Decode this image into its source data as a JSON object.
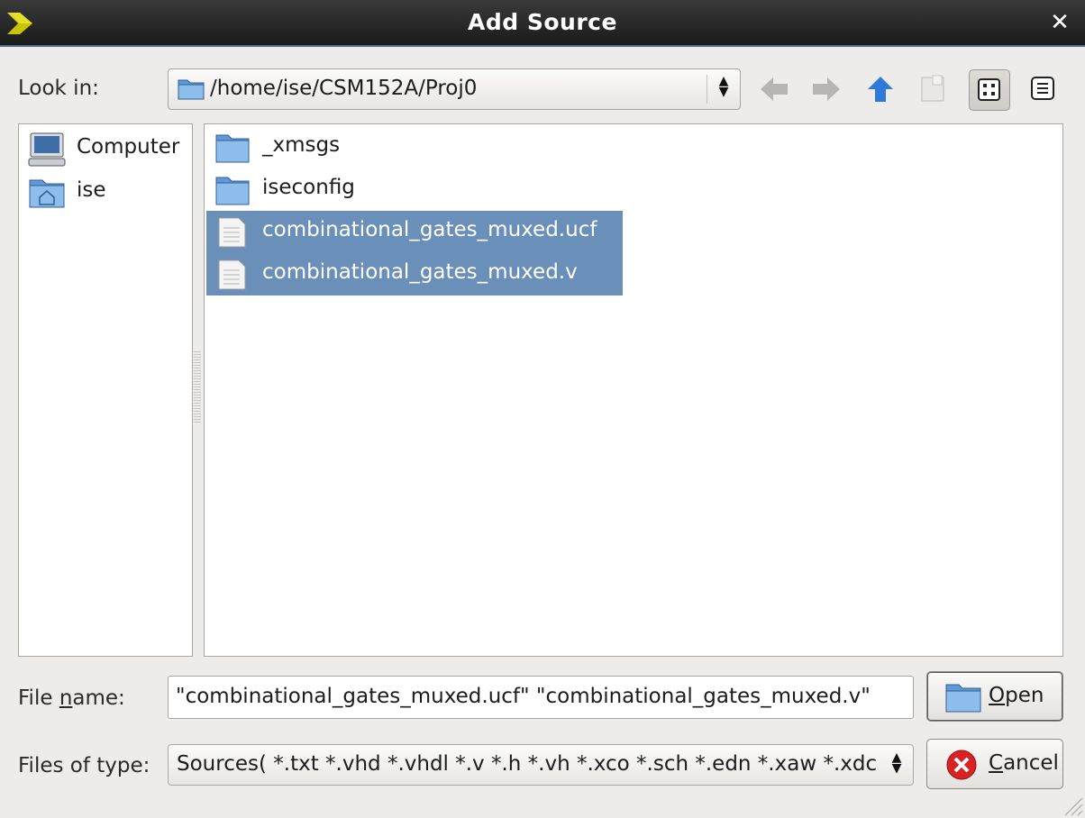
{
  "window": {
    "title": "Add Source"
  },
  "toolbar": {
    "look_in_label": "Look in:",
    "look_in_path": "/home/ise/CSM152A/Proj0",
    "back_icon": "arrow-left-icon",
    "forward_icon": "arrow-right-icon",
    "up_icon": "arrow-up-icon",
    "new_folder_icon": "new-folder-icon",
    "list_view_icon": "list-view-icon",
    "detail_view_icon": "detail-view-icon",
    "active_view": "list"
  },
  "sidebar": {
    "items": [
      {
        "label": "Computer",
        "icon": "computer-icon"
      },
      {
        "label": "ise",
        "icon": "home-folder-icon"
      }
    ]
  },
  "files": [
    {
      "name": "_xmsgs",
      "kind": "folder",
      "selected": false
    },
    {
      "name": "iseconfig",
      "kind": "folder",
      "selected": false
    },
    {
      "name": "combinational_gates_muxed.ucf",
      "kind": "file",
      "selected": true
    },
    {
      "name": "combinational_gates_muxed.v",
      "kind": "file",
      "selected": true
    }
  ],
  "bottom": {
    "file_name_label_pre": "File ",
    "file_name_label_mnemonic": "n",
    "file_name_label_post": "ame:",
    "file_name_value": "\"combinational_gates_muxed.ucf\" \"combinational_gates_muxed.v\"",
    "files_of_type_label": "Files of type:",
    "files_of_type_value": "Sources( *.txt *.vhd *.vhdl *.v *.h *.vh *.xco *.sch *.edn *.xaw *.xdc *.ucf )"
  },
  "buttons": {
    "open_mnemonic": "O",
    "open_rest": "pen",
    "cancel_mnemonic": "C",
    "cancel_rest": "ancel"
  },
  "colors": {
    "selection": "#6a8fb8",
    "accent_blue": "#3b7cc6",
    "titlebar": "#1f1f1f"
  }
}
